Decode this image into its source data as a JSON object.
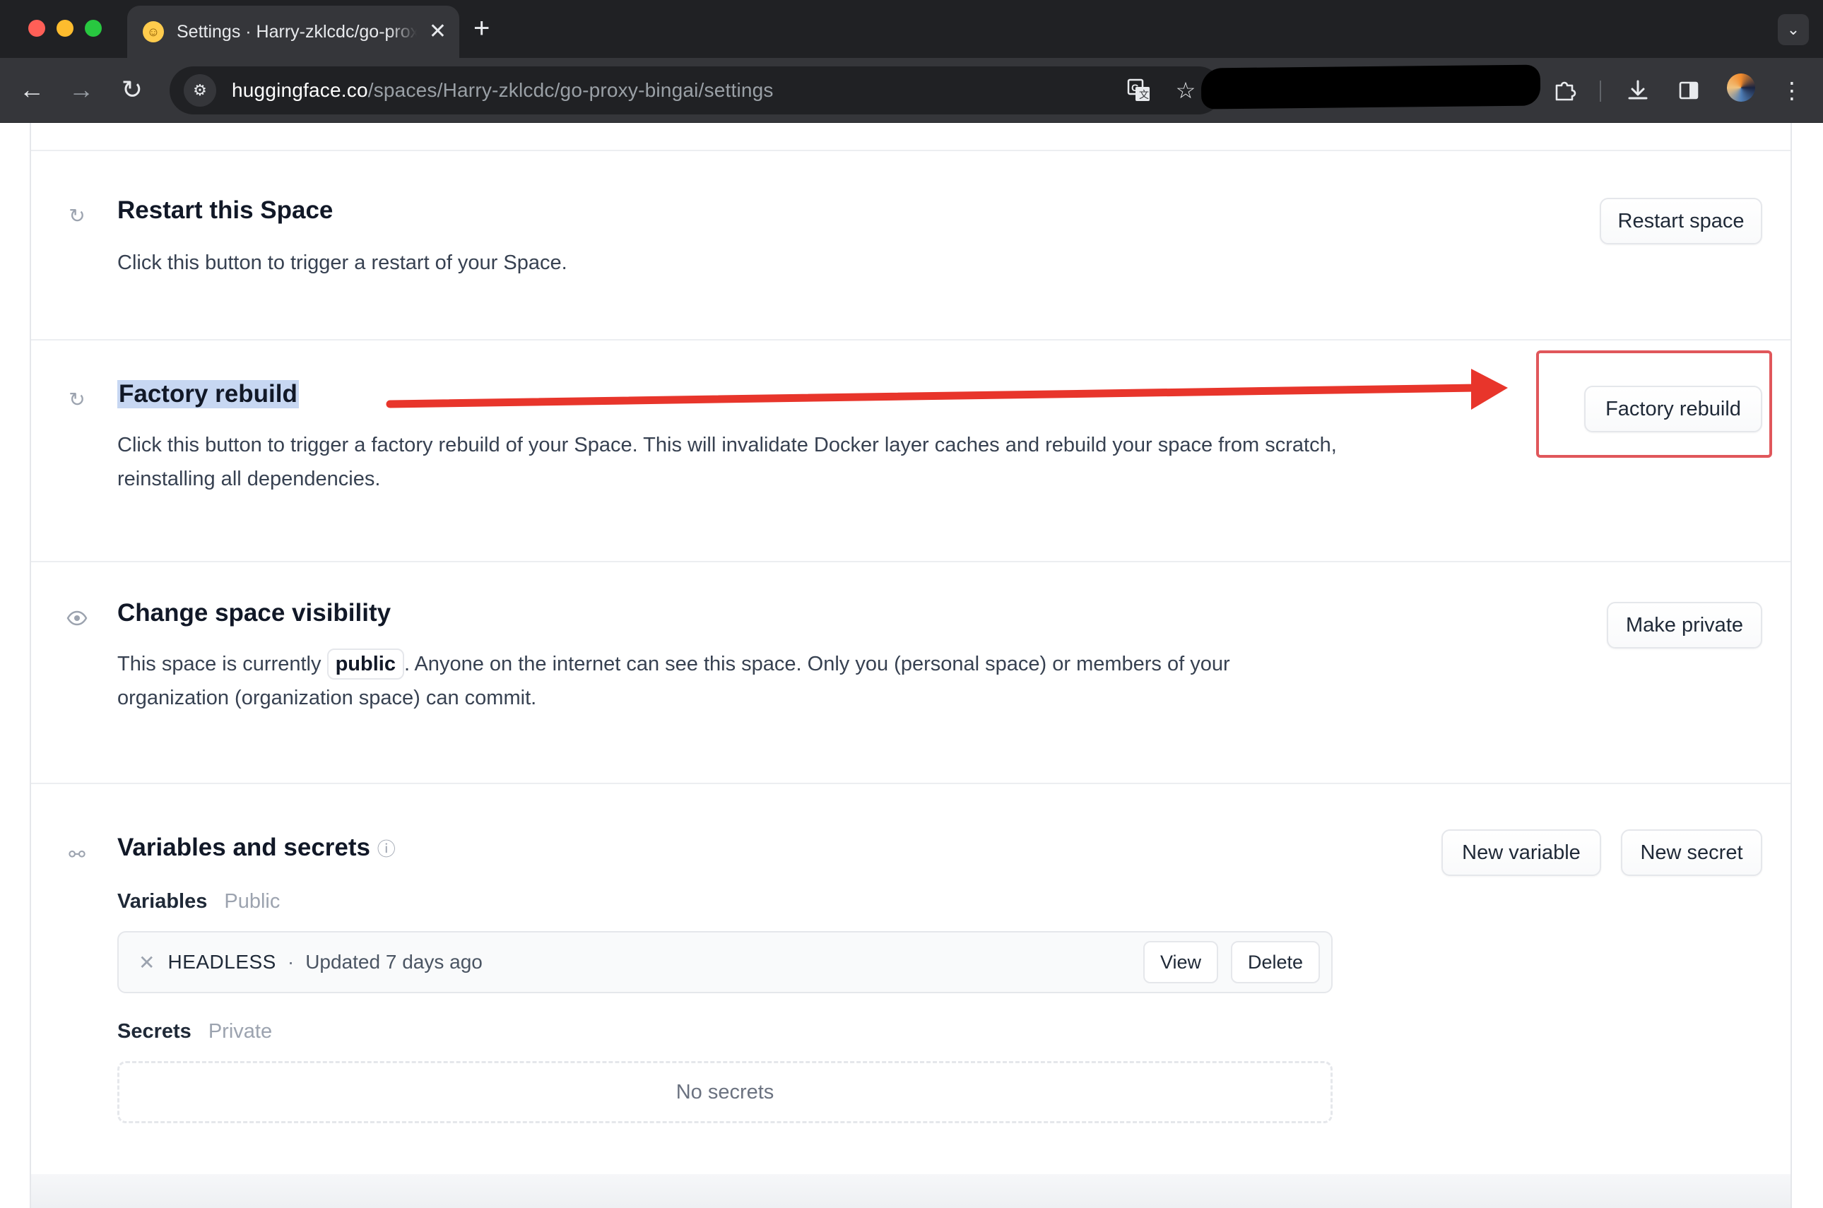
{
  "browser": {
    "tab_title": "Settings · Harry-zklcdc/go-proxy-bingai",
    "tab_close": "✕",
    "new_tab": "+",
    "url_host": "huggingface.co",
    "url_path": "/spaces/Harry-zklcdc/go-proxy-bingai/settings"
  },
  "sections": {
    "restart": {
      "title": "Restart this Space",
      "description": "Click this button to trigger a restart of your Space.",
      "button": "Restart space"
    },
    "factory": {
      "title": "Factory rebuild",
      "description": "Click this button to trigger a factory rebuild of your Space. This will invalidate Docker layer caches and rebuild your space from scratch, reinstalling all dependencies.",
      "button": "Factory rebuild"
    },
    "visibility": {
      "title": "Change space visibility",
      "desc_before": "This space is currently",
      "status": "public",
      "desc_after": ". Anyone on the internet can see this space. Only you (personal space) or members of your organization (organization space) can commit.",
      "button": "Make private"
    },
    "variables": {
      "title": "Variables and secrets",
      "new_variable": "New variable",
      "new_secret": "New secret",
      "variables_label": "Variables",
      "variables_tag": "Public",
      "items": [
        {
          "name": "HEADLESS",
          "updated": "Updated 7 days ago",
          "view": "View",
          "delete": "Delete"
        }
      ],
      "secrets_label": "Secrets",
      "secrets_tag": "Private",
      "secrets_empty": "No secrets"
    }
  },
  "colors": {
    "annotation_red": "#e8352b",
    "highlight": "#c7d7f2"
  }
}
